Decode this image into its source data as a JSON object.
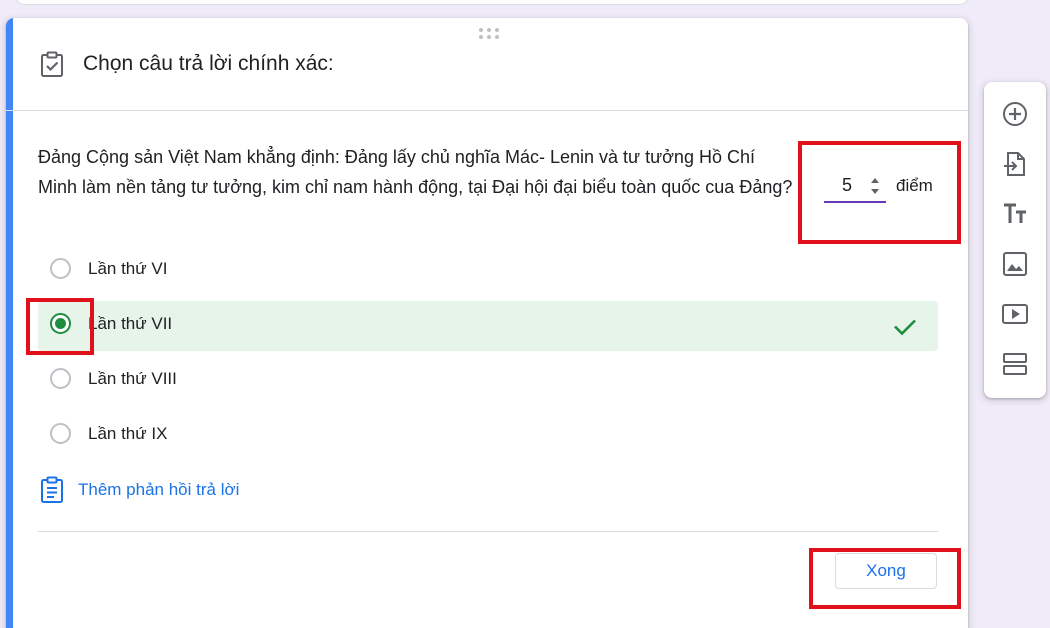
{
  "header": {
    "title": "Chọn câu trả lời chính xác:"
  },
  "question": {
    "text": "Đảng Cộng sản Việt Nam khẳng định: Đảng lấy chủ nghĩa Mác- Lenin và tư tưởng Hồ Chí Minh làm nền tảng tư tưởng, kim chỉ nam hành động, tại Đại hội đại biểu toàn quốc cua Đảng?",
    "points_value": "5",
    "points_label": "điểm"
  },
  "options": [
    {
      "label": "Lần thứ VI",
      "selected": false
    },
    {
      "label": "Lần thứ VII",
      "selected": true,
      "correct": true
    },
    {
      "label": "Lần thứ VIII",
      "selected": false
    },
    {
      "label": "Lần thứ IX",
      "selected": false
    }
  ],
  "feedback": {
    "label": "Thêm phản hồi trả lời"
  },
  "footer": {
    "done_label": "Xong"
  },
  "toolbar": {
    "icons": [
      "add-question-icon",
      "import-questions-icon",
      "add-title-icon",
      "add-image-icon",
      "add-video-icon",
      "add-section-icon"
    ]
  },
  "colors": {
    "accent": "#4285f4",
    "correct": "#1e8e3e",
    "correct_bg": "#e6f4ea",
    "link": "#1a73e8",
    "highlight": "#e0111b",
    "page_bg": "#f0ebf8"
  }
}
